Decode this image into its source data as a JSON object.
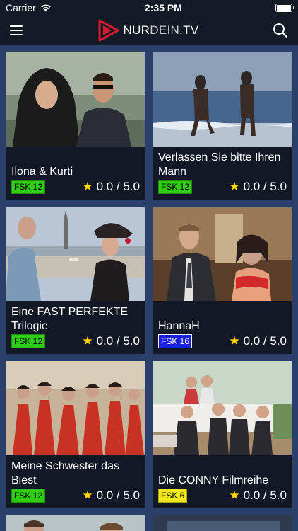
{
  "status_bar": {
    "carrier": "Carrier",
    "time": "2:35 PM"
  },
  "logo": {
    "part1": "NUR",
    "part2": "DEIN",
    "part3": ".TV"
  },
  "colors": {
    "background": "#2b3f6b",
    "card": "#121826",
    "nav": "#141a26",
    "star": "#ffd400",
    "logo_red": "#d8192b"
  },
  "movies": [
    {
      "title": "Ilona & Kurti",
      "fsk": "FSK 12",
      "fsk_color": "#2ecc12",
      "rating": "0.0 / 5.0",
      "thumb": "t1"
    },
    {
      "title": "Verlassen Sie bitte Ihren Mann",
      "fsk": "FSK 12",
      "fsk_color": "#2ecc12",
      "rating": "0.0 / 5.0",
      "thumb": "t2"
    },
    {
      "title": "Eine FAST PERFEKTE Trilogie",
      "fsk": "FSK 12",
      "fsk_color": "#2ecc12",
      "rating": "0.0 / 5.0",
      "thumb": "t3"
    },
    {
      "title": "HannaH",
      "fsk": "FSK 16",
      "fsk_color": "#1a20e0",
      "rating": "0.0 / 5.0",
      "thumb": "t4"
    },
    {
      "title": "Meine Schwester das Biest",
      "fsk": "FSK 12",
      "fsk_color": "#2ecc12",
      "rating": "0.0 / 5.0",
      "thumb": "t5"
    },
    {
      "title": "Die CONNY Filmreihe",
      "fsk": "FSK 6",
      "fsk_color": "#f2ea1c",
      "rating": "0.0 / 5.0",
      "thumb": "t6"
    }
  ]
}
